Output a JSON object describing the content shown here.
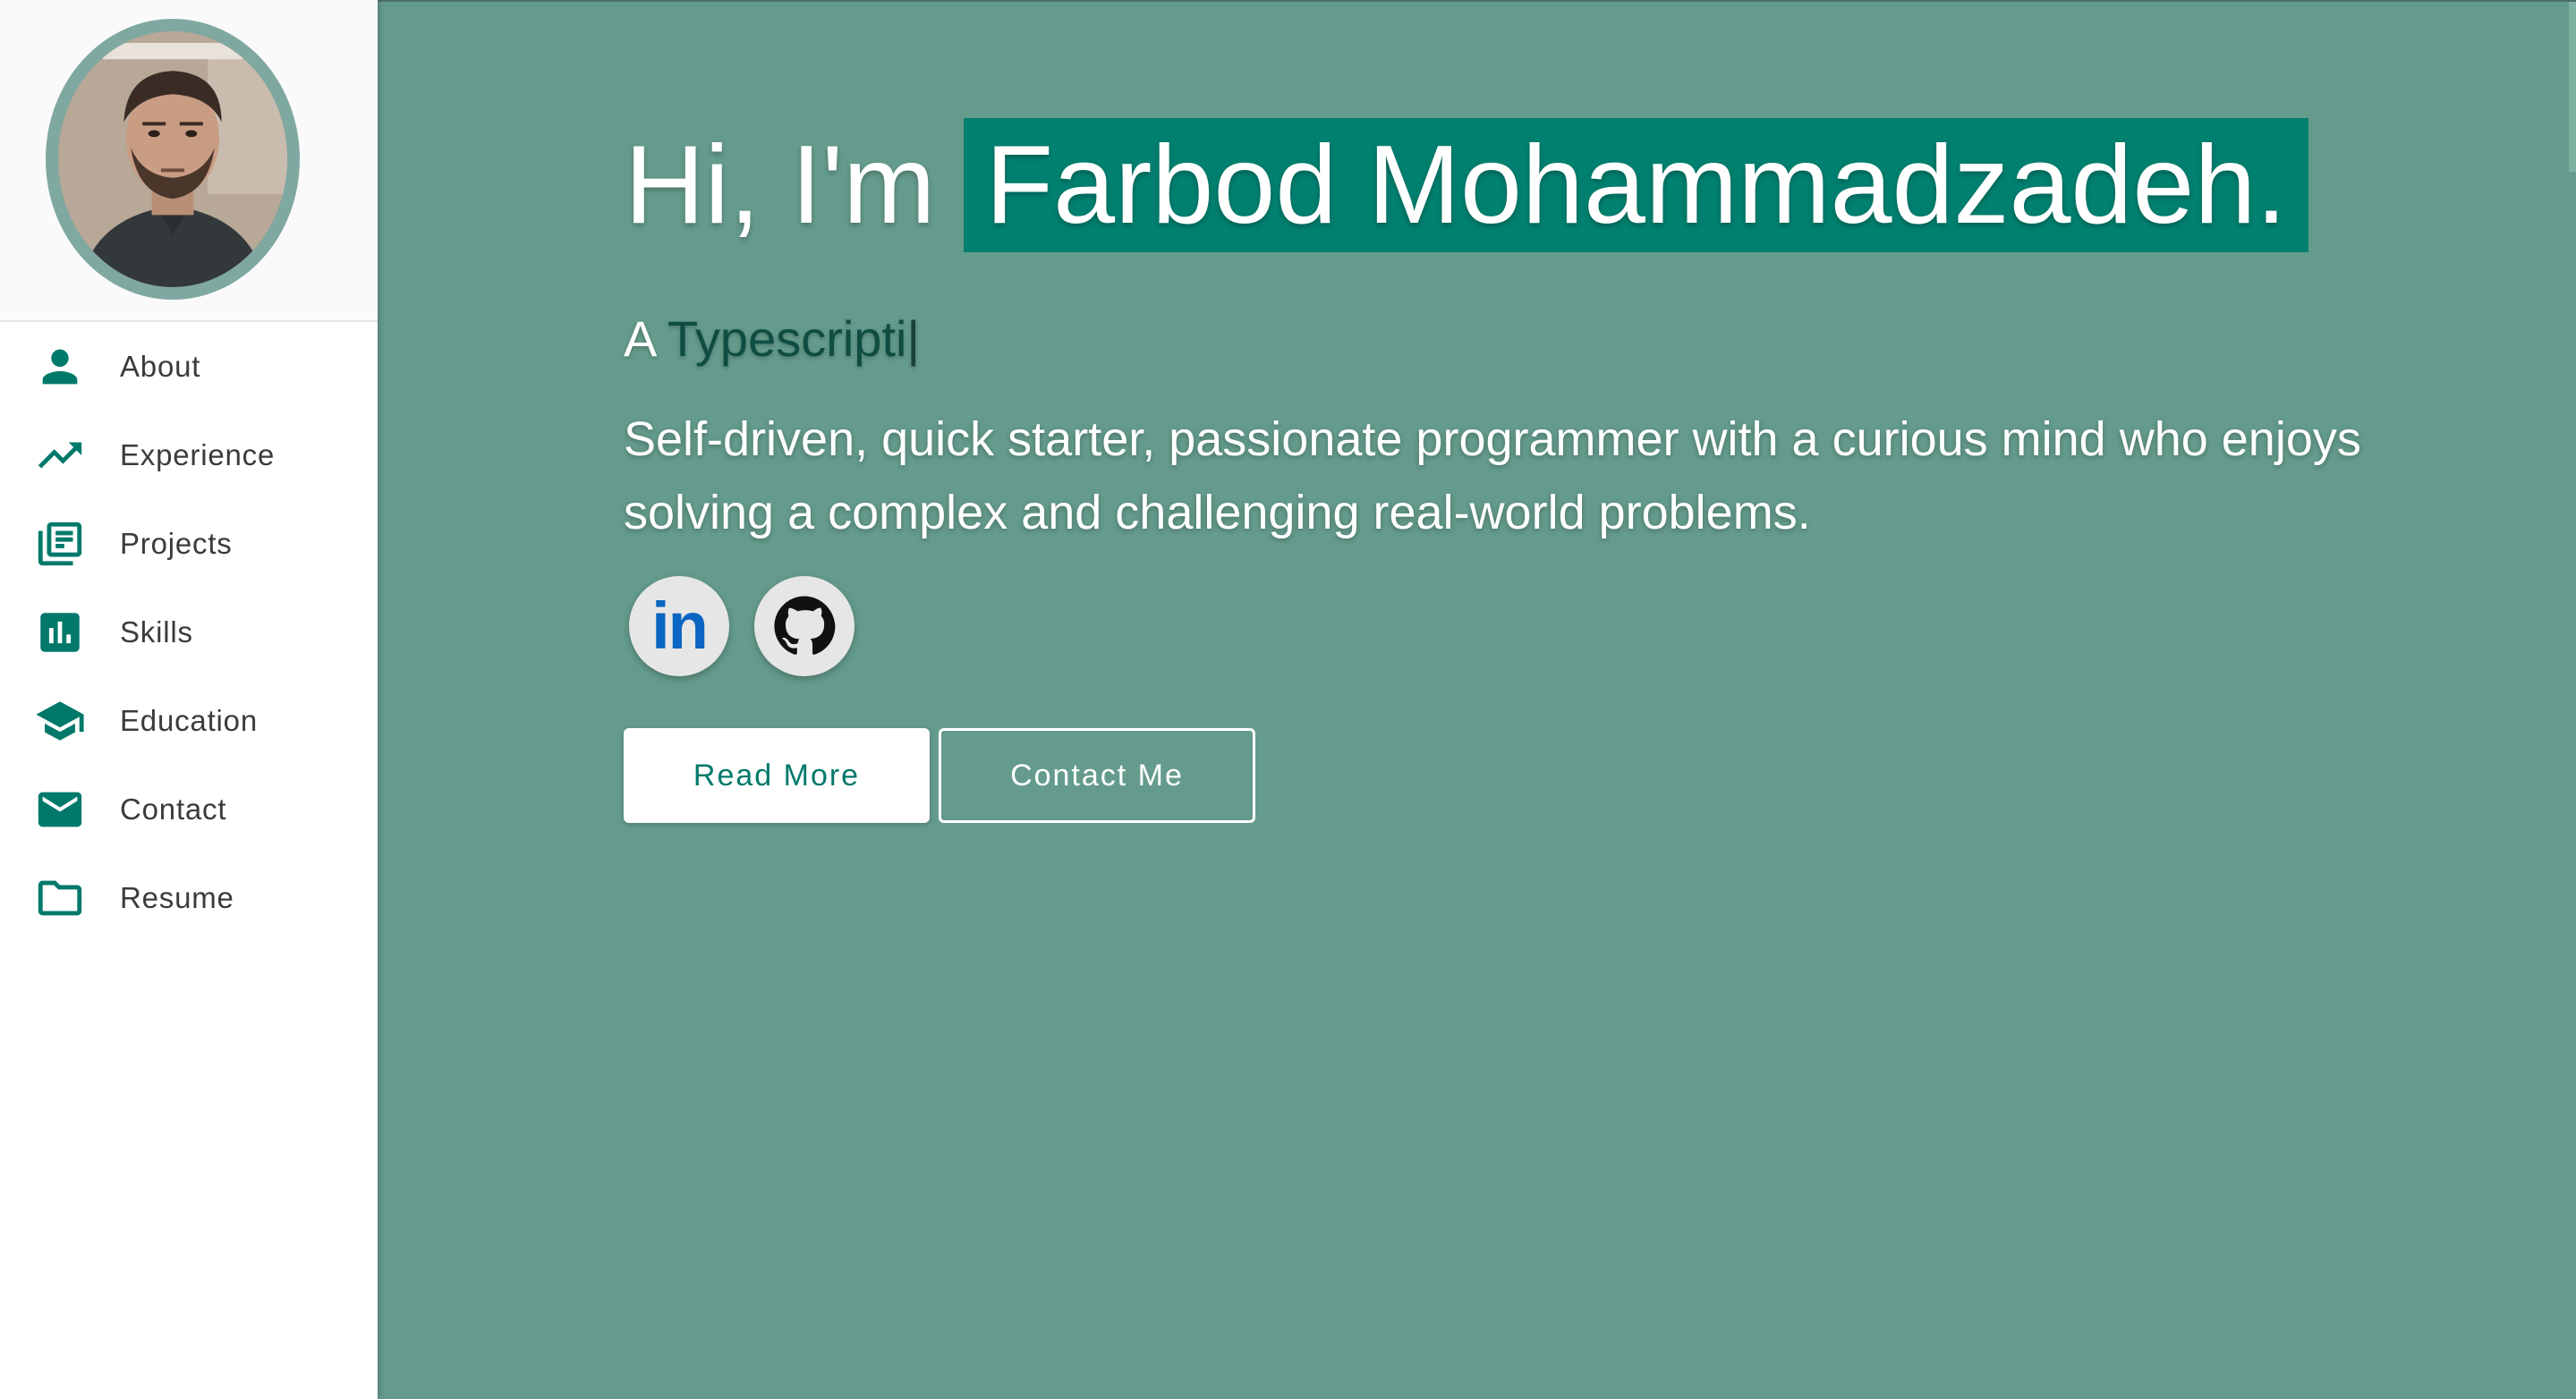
{
  "sidebar": {
    "profile_alt": "Profile photo",
    "items": [
      {
        "label": "About",
        "icon": "person-icon"
      },
      {
        "label": "Experience",
        "icon": "trending-up-icon"
      },
      {
        "label": "Projects",
        "icon": "library-books-icon"
      },
      {
        "label": "Skills",
        "icon": "bar-chart-icon"
      },
      {
        "label": "Education",
        "icon": "school-icon"
      },
      {
        "label": "Contact",
        "icon": "mail-icon"
      },
      {
        "label": "Resume",
        "icon": "folder-icon"
      }
    ]
  },
  "hero": {
    "greeting": "Hi, I'm",
    "name": "Farbod Mohammadzadeh.",
    "typing_prefix": "A",
    "typing_text": "Typescripti",
    "typing_cursor": "|",
    "tagline": "Self-driven, quick starter, passionate programmer with a curious mind who enjoys solving a complex and challenging real-world problems."
  },
  "socials": [
    {
      "name": "linkedin-icon",
      "text": "in"
    },
    {
      "name": "github-icon"
    }
  ],
  "buttons": {
    "read_more": "Read More",
    "contact_me": "Contact Me"
  },
  "colors": {
    "accent": "#00796b",
    "main_bg": "#649b8c",
    "name_highlight": "#00806f",
    "linkedin": "#0a66c2"
  }
}
